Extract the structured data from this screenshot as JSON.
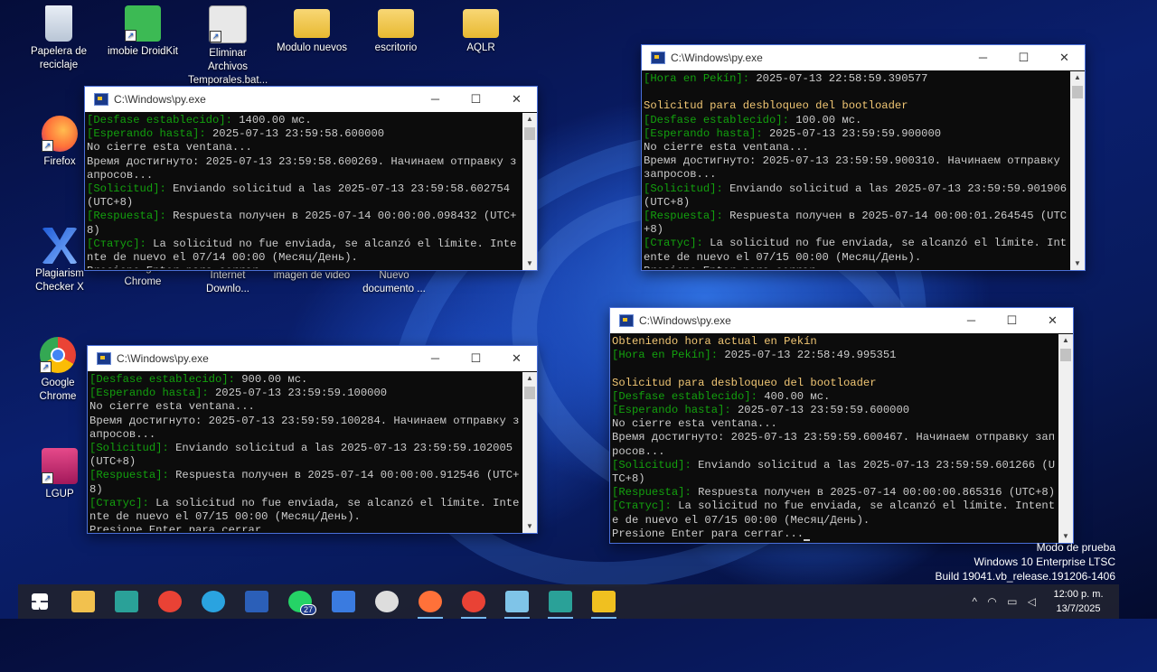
{
  "desktop_icons": [
    {
      "label": "Papelera de reciclaje",
      "icon": "recycle-bin-icon"
    },
    {
      "label": "imobie DroidKit",
      "icon": "droidkit-icon"
    },
    {
      "label": "Eliminar Archivos Temporales.bat...",
      "icon": "batch-file-icon"
    },
    {
      "label": "Modulo nuevos",
      "icon": "folder-icon"
    },
    {
      "label": "escritorio",
      "icon": "folder-icon"
    },
    {
      "label": "AQLR",
      "icon": "folder-icon"
    },
    {
      "label": "Firefox",
      "icon": "firefox-icon"
    },
    {
      "label": "Plagiarism Checker X",
      "icon": "plagiarism-checker-icon"
    },
    {
      "label": "Google Chrome",
      "icon": "chrome-icon"
    },
    {
      "label": "Internet Downlo...",
      "icon": "download-manager-icon"
    },
    {
      "label": "imagen de video",
      "icon": "image-icon"
    },
    {
      "label": "Nuevo documento ...",
      "icon": "document-icon"
    },
    {
      "label": "Google Chrome",
      "icon": "chrome-icon"
    },
    {
      "label": "LGUP",
      "icon": "lgup-icon"
    }
  ],
  "windows": [
    {
      "title": "C:\\Windows\\py.exe",
      "lines": [
        {
          "label": "[Desfase establecido]:",
          "text": " 1400.00 мс."
        },
        {
          "label": "[Esperando hasta]:",
          "text": " 2025-07-13 23:59:58.600000"
        },
        {
          "label": "",
          "text": "No cierre esta ventana..."
        },
        {
          "label": "",
          "text": "Время достигнуто: 2025-07-13 23:59:58.600269. Начинаем отправку запросов..."
        },
        {
          "label": "[Solicitud]:",
          "text": " Enviando solicitud a las 2025-07-13 23:59:58.602754 (UTC+8)"
        },
        {
          "label": "[Respuesta]:",
          "text": " Respuesta получен в 2025-07-14 00:00:00.098432 (UTC+8)"
        },
        {
          "label": "[Статус]:",
          "text": " La solicitud no fue enviada, se alcanzó el límite. Intente de nuevo el 07/14 00:00 (Месяц/День)."
        },
        {
          "label": "",
          "text": "Presione Enter para cerrar...",
          "cursor": true
        }
      ]
    },
    {
      "title": "C:\\Windows\\py.exe",
      "lines": [
        {
          "label": "[Hora en Pekín]:",
          "text": " 2025-07-13 22:58:59.390577"
        },
        {
          "label": "",
          "text": " "
        },
        {
          "label": "",
          "heading": "Solicitud para desbloqueo del bootloader"
        },
        {
          "label": "[Desfase establecido]:",
          "text": " 100.00 мс."
        },
        {
          "label": "[Esperando hasta]:",
          "text": " 2025-07-13 23:59:59.900000"
        },
        {
          "label": "",
          "text": "No cierre esta ventana..."
        },
        {
          "label": "",
          "text": "Время достигнуто: 2025-07-13 23:59:59.900310. Начинаем отправку запросов..."
        },
        {
          "label": "[Solicitud]:",
          "text": " Enviando solicitud a las 2025-07-13 23:59:59.901906 (UTC+8)"
        },
        {
          "label": "[Respuesta]:",
          "text": " Respuesta получен в 2025-07-14 00:00:01.264545 (UTC+8)"
        },
        {
          "label": "[Статус]:",
          "text": " La solicitud no fue enviada, se alcanzó el límite. Intente de nuevo el 07/15 00:00 (Месяц/День)."
        },
        {
          "label": "",
          "text": "Presione Enter para cerrar...",
          "cursor": true
        }
      ]
    },
    {
      "title": "C:\\Windows\\py.exe",
      "lines": [
        {
          "label": "[Desfase establecido]:",
          "text": " 900.00 мс."
        },
        {
          "label": "[Esperando hasta]:",
          "text": " 2025-07-13 23:59:59.100000"
        },
        {
          "label": "",
          "text": "No cierre esta ventana..."
        },
        {
          "label": "",
          "text": "Время достигнуто: 2025-07-13 23:59:59.100284. Начинаем отправку запросов..."
        },
        {
          "label": "[Solicitud]:",
          "text": " Enviando solicitud a las 2025-07-13 23:59:59.102005 (UTC+8)"
        },
        {
          "label": "[Respuesta]:",
          "text": " Respuesta получен в 2025-07-14 00:00:00.912546 (UTC+8)"
        },
        {
          "label": "[Статус]:",
          "text": " La solicitud no fue enviada, se alcanzó el límite. Intente de nuevo el 07/15 00:00 (Месяц/День)."
        },
        {
          "label": "",
          "text": "Presione Enter para cerrar...",
          "cursor": true
        }
      ]
    },
    {
      "title": "C:\\Windows\\py.exe",
      "lines": [
        {
          "label": "",
          "heading": "Obteniendo hora actual en Pekín"
        },
        {
          "label": "[Hora en Pekín]:",
          "text": " 2025-07-13 22:58:49.995351"
        },
        {
          "label": "",
          "text": " "
        },
        {
          "label": "",
          "heading": "Solicitud para desbloqueo del bootloader"
        },
        {
          "label": "[Desfase establecido]:",
          "text": " 400.00 мс."
        },
        {
          "label": "[Esperando hasta]:",
          "text": " 2025-07-13 23:59:59.600000"
        },
        {
          "label": "",
          "text": "No cierre esta ventana..."
        },
        {
          "label": "",
          "text": "Время достигнуто: 2025-07-13 23:59:59.600467. Начинаем отправку запросов..."
        },
        {
          "label": "[Solicitud]:",
          "text": " Enviando solicitud a las 2025-07-13 23:59:59.601266 (UTC+8)"
        },
        {
          "label": "[Respuesta]:",
          "text": " Respuesta получен в 2025-07-14 00:00:00.865316 (UTC+8)"
        },
        {
          "label": "[Статус]:",
          "text": " La solicitud no fue enviada, se alcanzó el límite. Intente de nuevo el 07/15 00:00 (Месяц/День)."
        },
        {
          "label": "",
          "text": "Presione Enter para cerrar...",
          "cursor": true
        }
      ]
    }
  ],
  "watermark": {
    "line1": "Modo de prueba",
    "line2": "Windows 10 Enterprise LTSC",
    "line3": "Build 19041.vb_release.191206-1406"
  },
  "taskbar": {
    "items": [
      {
        "icon": "start-icon",
        "color": "#ffffff"
      },
      {
        "icon": "file-explorer-icon",
        "color": "#f2c14e"
      },
      {
        "icon": "terminal-icon",
        "color": "#2aa198"
      },
      {
        "icon": "chrome-icon",
        "color": "#e94235"
      },
      {
        "icon": "telegram-icon",
        "color": "#2aa3e0"
      },
      {
        "icon": "word-icon",
        "color": "#2b5fb8"
      },
      {
        "icon": "whatsapp-icon",
        "color": "#25d366",
        "badge": "27"
      },
      {
        "icon": "store-icon",
        "color": "#3a7be0"
      },
      {
        "icon": "chatgpt-icon",
        "color": "#dddddd"
      },
      {
        "icon": "firefox-icon",
        "color": "#ff7139"
      },
      {
        "icon": "chrome-profile-icon",
        "color": "#e94235"
      },
      {
        "icon": "notes-icon",
        "color": "#7fc4e8"
      },
      {
        "icon": "terminal-icon",
        "color": "#2aa198"
      },
      {
        "icon": "python-icon",
        "color": "#f0c020"
      }
    ],
    "clock_time": "12:00 p. m.",
    "clock_date": "13/7/2025"
  }
}
